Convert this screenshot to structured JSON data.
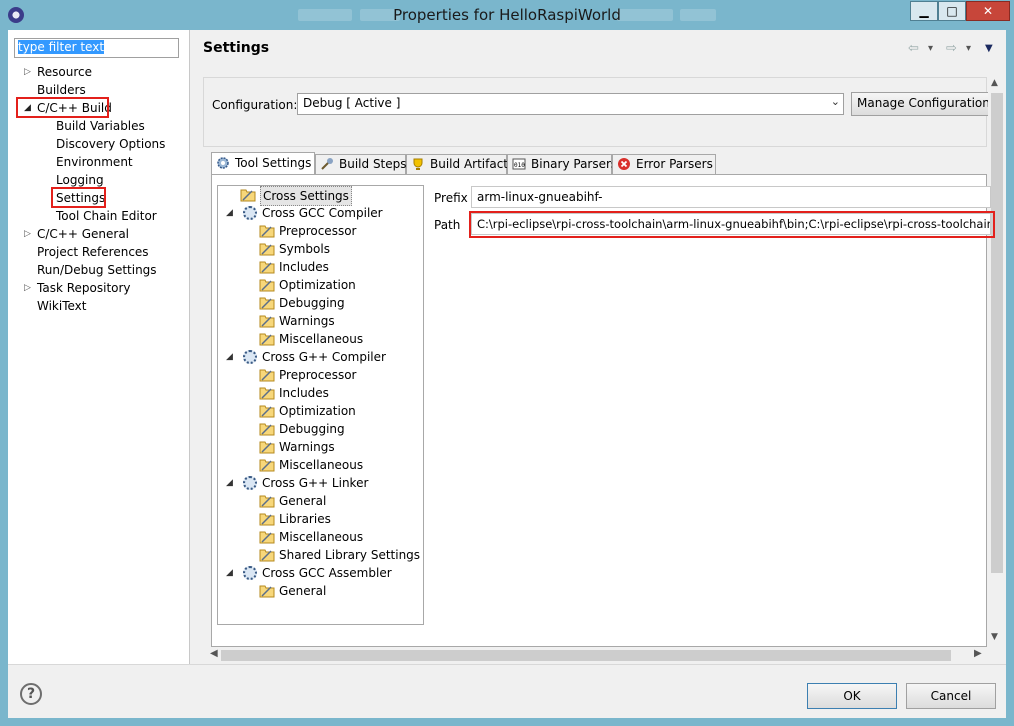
{
  "window": {
    "title": "Properties for HelloRaspiWorld",
    "minimize": "▁",
    "maximize": "□",
    "close": "✕"
  },
  "filter": {
    "placeholder": "type filter text"
  },
  "nav_tree": [
    {
      "label": "Resource",
      "arrow": "▷"
    },
    {
      "label": "Builders",
      "arrow": ""
    },
    {
      "label": "C/C++ Build",
      "arrow": "◢"
    },
    {
      "label": "Build Variables",
      "arrow": ""
    },
    {
      "label": "Discovery Options",
      "arrow": ""
    },
    {
      "label": "Environment",
      "arrow": ""
    },
    {
      "label": "Logging",
      "arrow": ""
    },
    {
      "label": "Settings",
      "arrow": ""
    },
    {
      "label": "Tool Chain Editor",
      "arrow": ""
    },
    {
      "label": "C/C++ General",
      "arrow": "▷"
    },
    {
      "label": "Project References",
      "arrow": ""
    },
    {
      "label": "Run/Debug Settings",
      "arrow": ""
    },
    {
      "label": "Task Repository",
      "arrow": "▷"
    },
    {
      "label": "WikiText",
      "arrow": ""
    }
  ],
  "page": {
    "title": "Settings",
    "nav": {
      "back": "⇦",
      "back_menu": "▾",
      "forward": "⇨",
      "forward_menu": "▾",
      "menu": "▼"
    }
  },
  "configuration": {
    "label": "Configuration:",
    "value": "Debug  [ Active ]",
    "chevron": "⌄",
    "manage_label": "Manage Configurations..."
  },
  "tabs": [
    {
      "label": "Tool Settings",
      "icon": "tool-settings-icon"
    },
    {
      "label": "Build Steps",
      "icon": "build-steps-icon"
    },
    {
      "label": "Build Artifact",
      "icon": "build-artifact-icon"
    },
    {
      "label": "Binary Parsers",
      "icon": "binary-parsers-icon"
    },
    {
      "label": "Error Parsers",
      "icon": "error-parsers-icon"
    }
  ],
  "tool_tree": [
    {
      "label": "Cross Settings",
      "level": 1,
      "kind": "folder",
      "arrow": ""
    },
    {
      "label": "Cross GCC Compiler",
      "level": 1,
      "kind": "gear",
      "arrow": "◢"
    },
    {
      "label": "Preprocessor",
      "level": 2,
      "kind": "folder",
      "arrow": ""
    },
    {
      "label": "Symbols",
      "level": 2,
      "kind": "folder",
      "arrow": ""
    },
    {
      "label": "Includes",
      "level": 2,
      "kind": "folder",
      "arrow": ""
    },
    {
      "label": "Optimization",
      "level": 2,
      "kind": "folder",
      "arrow": ""
    },
    {
      "label": "Debugging",
      "level": 2,
      "kind": "folder",
      "arrow": ""
    },
    {
      "label": "Warnings",
      "level": 2,
      "kind": "folder",
      "arrow": ""
    },
    {
      "label": "Miscellaneous",
      "level": 2,
      "kind": "folder",
      "arrow": ""
    },
    {
      "label": "Cross G++ Compiler",
      "level": 1,
      "kind": "gear",
      "arrow": "◢"
    },
    {
      "label": "Preprocessor",
      "level": 2,
      "kind": "folder",
      "arrow": ""
    },
    {
      "label": "Includes",
      "level": 2,
      "kind": "folder",
      "arrow": ""
    },
    {
      "label": "Optimization",
      "level": 2,
      "kind": "folder",
      "arrow": ""
    },
    {
      "label": "Debugging",
      "level": 2,
      "kind": "folder",
      "arrow": ""
    },
    {
      "label": "Warnings",
      "level": 2,
      "kind": "folder",
      "arrow": ""
    },
    {
      "label": "Miscellaneous",
      "level": 2,
      "kind": "folder",
      "arrow": ""
    },
    {
      "label": "Cross G++ Linker",
      "level": 1,
      "kind": "gear",
      "arrow": "◢"
    },
    {
      "label": "General",
      "level": 2,
      "kind": "folder",
      "arrow": ""
    },
    {
      "label": "Libraries",
      "level": 2,
      "kind": "folder",
      "arrow": ""
    },
    {
      "label": "Miscellaneous",
      "level": 2,
      "kind": "folder",
      "arrow": ""
    },
    {
      "label": "Shared Library Settings",
      "level": 2,
      "kind": "folder",
      "arrow": ""
    },
    {
      "label": "Cross GCC Assembler",
      "level": 1,
      "kind": "gear",
      "arrow": "◢"
    },
    {
      "label": "General",
      "level": 2,
      "kind": "folder",
      "arrow": ""
    }
  ],
  "fields": {
    "prefix_label": "Prefix",
    "prefix_value": "arm-linux-gnueabihf-",
    "path_label": "Path",
    "path_value": "C:\\rpi-eclipse\\rpi-cross-toolchain\\arm-linux-gnueabihf\\bin;C:\\rpi-eclipse\\rpi-cross-toolchain\\min"
  },
  "scroll": {
    "up": "▲",
    "down": "▼",
    "left": "◀",
    "right": "▶"
  },
  "buttons": {
    "help": "?",
    "ok": "OK",
    "cancel": "Cancel"
  },
  "colors": {
    "highlight": "#e3201b",
    "selection": "#3399ff",
    "titlebar": "#7ab6cc"
  }
}
